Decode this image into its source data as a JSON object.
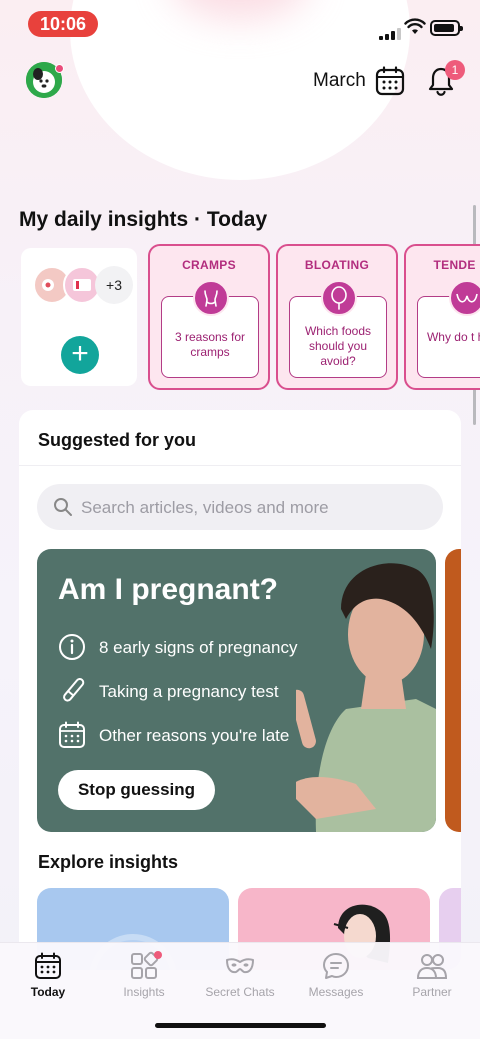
{
  "status_bar": {
    "time": "10:06"
  },
  "header": {
    "month_label": "March",
    "notification_count": "1"
  },
  "daily_insights": {
    "title": "My daily insights · Today",
    "more_count": "+3",
    "cards": [
      {
        "title": "CRAMPS",
        "text": "3 reasons for cramps"
      },
      {
        "title": "BLOATING",
        "text": "Which foods should you avoid?"
      },
      {
        "title": "TENDER BREASTS",
        "title_visible": "TENDE BREAST",
        "text": "Why do they hurt?",
        "text_visible": "Why do t hurt?"
      }
    ]
  },
  "suggested": {
    "title": "Suggested for you",
    "search_placeholder": "Search articles, videos and more",
    "promo": {
      "title": "Am I pregnant?",
      "items": [
        {
          "icon": "info-icon",
          "text": "8 early signs of pregnancy"
        },
        {
          "icon": "pregnancy-test-icon",
          "text": "Taking a pregnancy test"
        },
        {
          "icon": "calendar-icon",
          "text": "Other reasons you're late"
        }
      ],
      "cta": "Stop guessing",
      "bg_color": "#52726a"
    },
    "explore_title": "Explore insights"
  },
  "nav": {
    "items": [
      {
        "label": "Today",
        "icon": "calendar-icon",
        "active": true
      },
      {
        "label": "Insights",
        "icon": "insights-grid-icon",
        "badge": true
      },
      {
        "label": "Secret Chats",
        "icon": "mask-icon"
      },
      {
        "label": "Messages",
        "icon": "chat-bubble-icon"
      },
      {
        "label": "Partner",
        "icon": "partner-icon"
      }
    ]
  },
  "colors": {
    "accent_pink": "#d94f8e",
    "teal": "#12a59b",
    "badge": "#ee5b7b",
    "time_pill": "#e8413c"
  }
}
